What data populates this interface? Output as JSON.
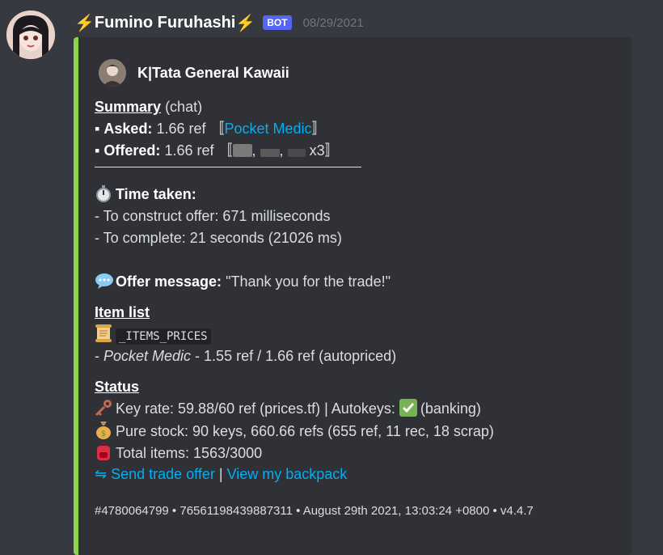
{
  "message": {
    "bolt": "⚡",
    "username": "Fumino Furuhashi",
    "badge": "BOT",
    "timestamp": "08/29/2021"
  },
  "embed": {
    "accent_color": "#8ed44d",
    "author": "K|Tata General Kawaii",
    "summary": {
      "heading": "Summary",
      "context": "(chat)",
      "bullet": "▪",
      "asked_label": "Asked:",
      "asked_value": "1.66 ref",
      "asked_open": "〚",
      "asked_item": "Pocket Medic",
      "asked_close": "〛",
      "offered_label": "Offered:",
      "offered_value": "1.66 ref",
      "offered_open": "〚",
      "offered_sep1": ",",
      "offered_sep2": ",",
      "offered_count": "x3",
      "offered_close": "〛"
    },
    "time": {
      "label": "Time taken:",
      "construct": "- To construct offer: 671 milliseconds",
      "complete": "- To complete: 21 seconds (21026 ms)"
    },
    "offer_message": {
      "label": "Offer message:",
      "value": "\"Thank you for the trade!\""
    },
    "item_list": {
      "heading": "Item list",
      "code": "_ITEMS_PRICES",
      "prefix": "- ",
      "item": "Pocket Medic",
      "detail": " - 1.55 ref / 1.66 ref (autopriced)"
    },
    "status": {
      "heading": "Status",
      "key_rate": "Key rate: 59.88/60 ref (prices.tf) | Autokeys:",
      "autokeys_state": "(banking)",
      "pure_stock": "Pure stock: 90 keys, 660.66 refs (655 ref, 11 rec, 18 scrap)",
      "total_items": "Total items: 1563/3000",
      "send_offer_link": "⇋ Send trade offer",
      "separator": "|",
      "backpack_link": "View my backpack"
    },
    "footer": "#4780064799 • 76561198439887311 • August 29th 2021, 13:03:24 +0800 • v4.4.7"
  }
}
